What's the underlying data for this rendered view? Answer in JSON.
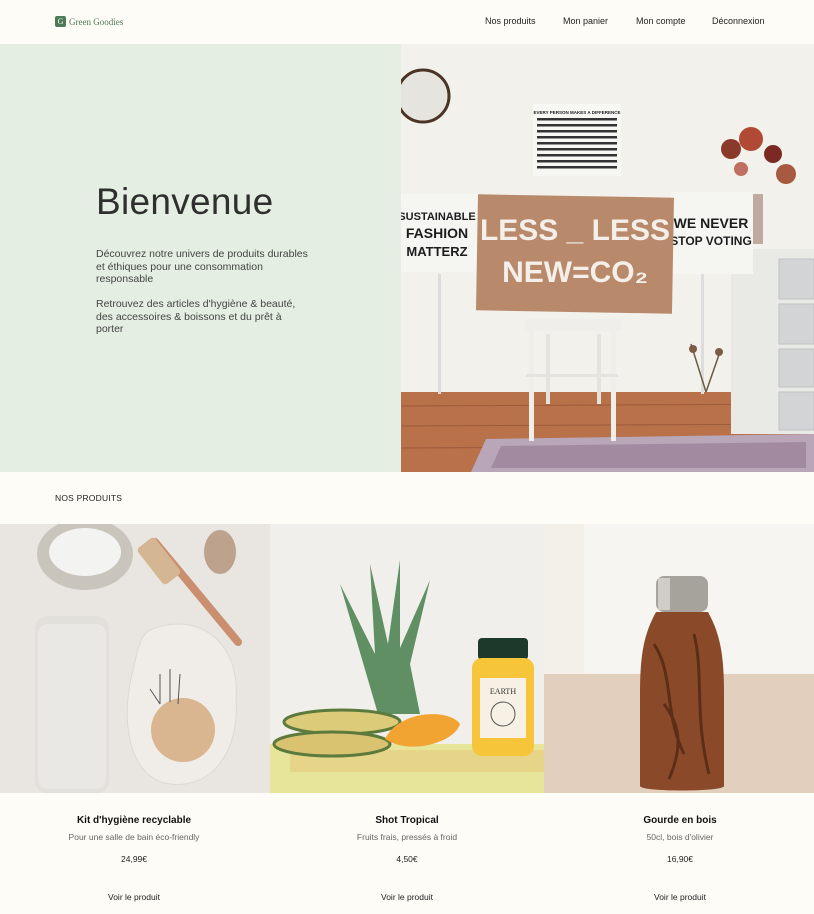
{
  "header": {
    "logo_letter": "G",
    "logo_text": "Green Goodies",
    "nav": [
      {
        "label": "Nos produits"
      },
      {
        "label": "Mon panier"
      },
      {
        "label": "Mon compte"
      },
      {
        "label": "Déconnexion"
      }
    ]
  },
  "hero": {
    "title": "Bienvenue",
    "paragraph1": "Découvrez notre univers de produits durables et éthiques pour une consommation responsable",
    "paragraph2": "Retrouvez des articles d'hygiène & beauté, des accessoires & boissons et du prêt à porter",
    "image": {
      "sign_main_line1": "LESS _ LESS",
      "sign_main_line2": "NEW=CO₂",
      "sign_left_line1": "SUSTAINABLE",
      "sign_left_line2": "FASHION",
      "sign_left_line3": "MATTERZ",
      "sign_right_line1": "WE NEVER",
      "sign_right_line2": "STOP VOTING",
      "poster_line": "EVERY PERSON MAKES A DIFFERENCE"
    }
  },
  "products_section": {
    "title": "NOS PRODUITS",
    "items": [
      {
        "name": "Kit d'hygiène recyclable",
        "description": "Pour une salle de bain éco-friendly",
        "price": "24,99€",
        "link": "Voir le produit"
      },
      {
        "name": "Shot Tropical",
        "description": "Fruits frais, pressés à froid",
        "price": "4,50€",
        "link": "Voir le produit",
        "jar_label": "EARTH"
      },
      {
        "name": "Gourde en bois",
        "description": "50cl, bois d'olivier",
        "price": "16,90€",
        "link": "Voir le produit"
      }
    ]
  },
  "colors": {
    "background": "#fdfcf6",
    "hero_panel": "#e4eee2",
    "brand_green": "#4e7a56"
  }
}
